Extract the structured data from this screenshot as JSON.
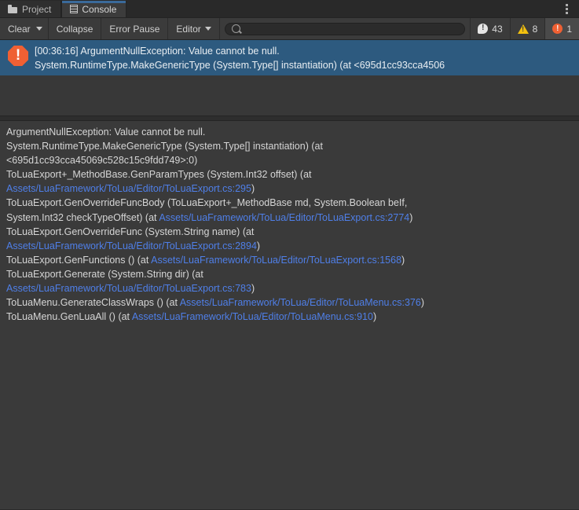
{
  "window": {
    "tabs": [
      {
        "label": "Project",
        "icon": "folder-icon",
        "active": false
      },
      {
        "label": "Console",
        "icon": "console-icon",
        "active": true
      }
    ],
    "menu_icon": "kebab-menu-icon"
  },
  "toolbar": {
    "clear_label": "Clear",
    "clear_dropdown_icon": "chevron-down-icon",
    "collapse_label": "Collapse",
    "error_pause_label": "Error Pause",
    "editor_label": "Editor",
    "editor_dropdown_icon": "chevron-down-icon",
    "search": {
      "value": "",
      "placeholder": "",
      "icon": "search-icon"
    },
    "counters": {
      "info": {
        "icon": "info-icon",
        "count": "43"
      },
      "warning": {
        "icon": "warning-icon",
        "count": "8"
      },
      "error": {
        "icon": "error-icon",
        "count": "1"
      }
    }
  },
  "log_list": {
    "entries": [
      {
        "icon": "error-icon",
        "selected": true,
        "line1": "[00:36:16] ArgumentNullException: Value cannot be null.",
        "line2": "System.RuntimeType.MakeGenericType (System.Type[] instantiation) (at <695d1cc93cca4506"
      }
    ]
  },
  "detail": {
    "lines": [
      [
        {
          "t": "ArgumentNullException: Value cannot be null.",
          "link": false
        }
      ],
      [
        {
          "t": "System.RuntimeType.MakeGenericType (System.Type[] instantiation) (at",
          "link": false
        }
      ],
      [
        {
          "t": "<695d1cc93cca45069c528c15c9fdd749>:0)",
          "link": false
        }
      ],
      [
        {
          "t": "ToLuaExport+_MethodBase.GenParamTypes (System.Int32 offset) (at",
          "link": false
        }
      ],
      [
        {
          "t": "Assets/LuaFramework/ToLua/Editor/ToLuaExport.cs:295",
          "link": true
        },
        {
          "t": ")",
          "link": false
        }
      ],
      [
        {
          "t": "ToLuaExport.GenOverrideFuncBody (ToLuaExport+_MethodBase md, System.Boolean beIf,",
          "link": false
        }
      ],
      [
        {
          "t": "System.Int32 checkTypeOffset) (at ",
          "link": false
        },
        {
          "t": "Assets/LuaFramework/ToLua/Editor/ToLuaExport.cs:2774",
          "link": true
        },
        {
          "t": ")",
          "link": false
        }
      ],
      [
        {
          "t": "ToLuaExport.GenOverrideFunc (System.String name) (at",
          "link": false
        }
      ],
      [
        {
          "t": "Assets/LuaFramework/ToLua/Editor/ToLuaExport.cs:2894",
          "link": true
        },
        {
          "t": ")",
          "link": false
        }
      ],
      [
        {
          "t": "ToLuaExport.GenFunctions () (at ",
          "link": false
        },
        {
          "t": "Assets/LuaFramework/ToLua/Editor/ToLuaExport.cs:1568",
          "link": true
        },
        {
          "t": ")",
          "link": false
        }
      ],
      [
        {
          "t": "ToLuaExport.Generate (System.String dir) (at",
          "link": false
        }
      ],
      [
        {
          "t": "Assets/LuaFramework/ToLua/Editor/ToLuaExport.cs:783",
          "link": true
        },
        {
          "t": ")",
          "link": false
        }
      ],
      [
        {
          "t": "ToLuaMenu.GenerateClassWraps () (at ",
          "link": false
        },
        {
          "t": "Assets/LuaFramework/ToLua/Editor/ToLuaMenu.cs:376",
          "link": true
        },
        {
          "t": ")",
          "link": false
        }
      ],
      [
        {
          "t": "ToLuaMenu.GenLuaAll () (at ",
          "link": false
        },
        {
          "t": "Assets/LuaFramework/ToLua/Editor/ToLuaMenu.cs:910",
          "link": true
        },
        {
          "t": ")",
          "link": false
        }
      ]
    ]
  },
  "colors": {
    "selection_blue": "#2d5a7f",
    "link_blue": "#4f7fe8",
    "error_orange": "#ef6033",
    "warning_yellow": "#f2c00f",
    "tab_accent": "#3a6a9a",
    "panel_bg": "#3a3a3a",
    "list_bg": "#383838"
  }
}
